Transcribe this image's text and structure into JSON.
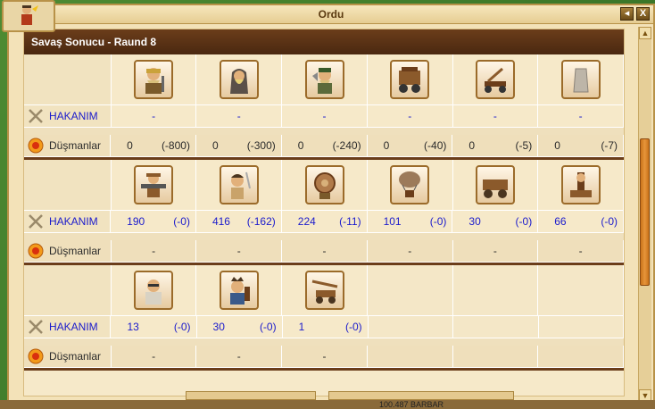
{
  "window": {
    "title": "Ordu",
    "back_label": "◂",
    "close_label": "X"
  },
  "section": {
    "title": "Savaş Sonucu - Raund 8"
  },
  "labels": {
    "mine": "HAKANIM",
    "enemy": "Düşmanlar"
  },
  "block1": {
    "icons": [
      "dwarf-warrior",
      "hooded-mage",
      "axe-warrior",
      "siege-cart",
      "catapult",
      "stone-wall"
    ],
    "mine": [
      "-",
      "-",
      "-",
      "-",
      "-",
      "-"
    ],
    "enemy": [
      {
        "value": "0",
        "delta": "(-800)"
      },
      {
        "value": "0",
        "delta": "(-300)"
      },
      {
        "value": "0",
        "delta": "(-240)"
      },
      {
        "value": "0",
        "delta": "(-40)"
      },
      {
        "value": "0",
        "delta": "(-5)"
      },
      {
        "value": "0",
        "delta": "(-7)"
      }
    ]
  },
  "block2": {
    "icons": [
      "cannon-soldier",
      "sword-fighter",
      "shield-warrior",
      "balloon",
      "cart",
      "ram"
    ],
    "mine": [
      {
        "value": "190",
        "delta": "(-0)"
      },
      {
        "value": "416",
        "delta": "(-162)"
      },
      {
        "value": "224",
        "delta": "(-11)"
      },
      {
        "value": "101",
        "delta": "(-0)"
      },
      {
        "value": "30",
        "delta": "(-0)"
      },
      {
        "value": "66",
        "delta": "(-0)"
      }
    ],
    "enemy": [
      "-",
      "-",
      "-",
      "-",
      "-",
      "-"
    ]
  },
  "block3": {
    "icons": [
      "elder-sage",
      "hero-king",
      "ballista"
    ],
    "mine": [
      {
        "value": "13",
        "delta": "(-0)"
      },
      {
        "value": "30",
        "delta": "(-0)"
      },
      {
        "value": "1",
        "delta": "(-0)"
      }
    ],
    "enemy": [
      "-",
      "-",
      "-"
    ]
  },
  "footer": {
    "partial_text": "100.487 BARBAR"
  },
  "colors": {
    "header": "#4a2810",
    "panel": "#f6e9c9",
    "link_blue": "#1a1acc",
    "scroll_thumb": "#e7953a"
  }
}
